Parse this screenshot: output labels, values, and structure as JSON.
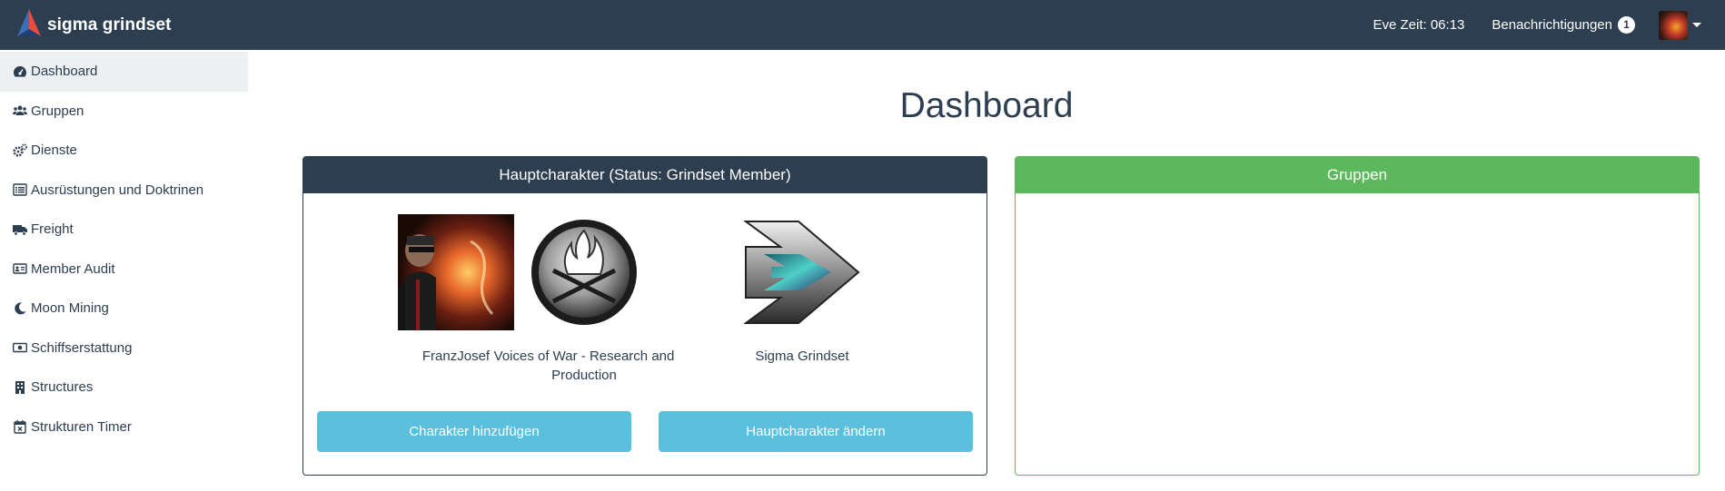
{
  "navbar": {
    "brand_name": "sigma grindset",
    "eve_time": "Eve Zeit: 06:13",
    "notifications_label": "Benachrichtigungen",
    "notifications_count": "1"
  },
  "sidebar": {
    "items": [
      {
        "label": "Dashboard",
        "icon": "tachometer-icon",
        "active": true
      },
      {
        "label": "Gruppen",
        "icon": "users-icon"
      },
      {
        "label": "Dienste",
        "icon": "cogs-icon"
      },
      {
        "label": "Ausrüstungen und Doktrinen",
        "icon": "list-alt-icon"
      },
      {
        "label": "Freight",
        "icon": "truck-icon"
      },
      {
        "label": "Member Audit",
        "icon": "id-card-icon"
      },
      {
        "label": "Moon Mining",
        "icon": "moon-icon"
      },
      {
        "label": "Schiffserstattung",
        "icon": "money-bill-icon"
      },
      {
        "label": "Structures",
        "icon": "building-icon"
      },
      {
        "label": "Strukturen Timer",
        "icon": "calendar-times-icon"
      }
    ]
  },
  "main": {
    "title": "Dashboard",
    "main_panel": {
      "heading": "Hauptcharakter (Status: Grindset Member)",
      "character": "FranzJosef",
      "corporation": "Voices of War - Research and Production",
      "alliance": "Sigma Grindset",
      "add_button": "Charakter hinzufügen",
      "change_button": "Hauptcharakter ändern"
    },
    "groups_panel": {
      "heading": "Gruppen"
    }
  },
  "colors": {
    "navbar": "#2c3e50",
    "primary": "#2c3e50",
    "success": "#5cb85c",
    "info": "#5bc0de",
    "sidebar_active": "#ecf0f1"
  }
}
